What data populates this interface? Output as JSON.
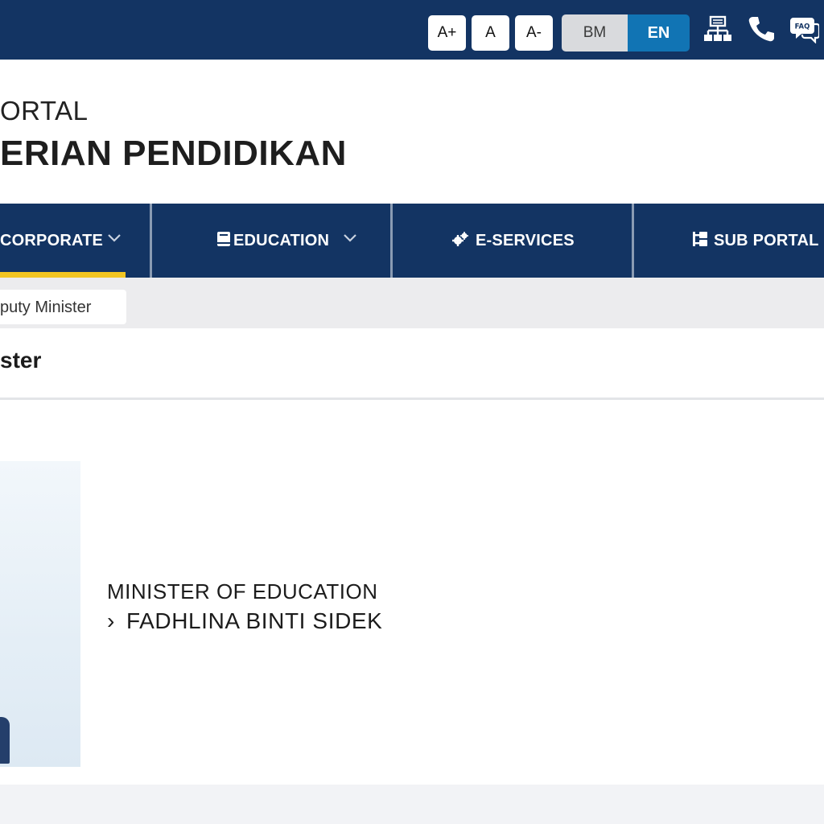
{
  "topbar": {
    "font_size_buttons": [
      "A+",
      "A",
      "A-"
    ],
    "languages": [
      {
        "code": "BM",
        "active": false
      },
      {
        "code": "EN",
        "active": true
      }
    ],
    "icons": [
      "sitemap-icon",
      "phone-icon",
      "faq-icon"
    ],
    "faq_badge": "FAQ"
  },
  "brand": {
    "line1": "ORTAL",
    "line2": "ERIAN PENDIDIKAN"
  },
  "nav": {
    "items": [
      {
        "label": "CORPORATE",
        "icon": "none",
        "has_dropdown": true,
        "active": true
      },
      {
        "label": "EDUCATION",
        "icon": "book-icon",
        "has_dropdown": true,
        "active": false
      },
      {
        "label": "E-SERVICES",
        "icon": "gears-icon",
        "has_dropdown": false,
        "active": false
      },
      {
        "label": "SUB PORTAL",
        "icon": "tree-icon",
        "has_dropdown": false,
        "active": false
      }
    ]
  },
  "breadcrumb": {
    "current": "puty Minister"
  },
  "page": {
    "title": "ster"
  },
  "minister": {
    "role": "MINISTER OF EDUCATION",
    "arrow": "›",
    "name": "FADHLINA BINTI SIDEK"
  },
  "colors": {
    "navy": "#133463",
    "accent_blue": "#1174b4",
    "active_underline": "#f2c522"
  }
}
